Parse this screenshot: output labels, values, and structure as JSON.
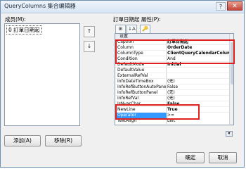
{
  "window": {
    "title": "QueryColumns 集合编辑器",
    "help_glyph": "?",
    "close_glyph": "✕"
  },
  "members": {
    "label": "成员(M):",
    "items": [
      "0 訂單日期起"
    ],
    "up_glyph": "↑",
    "down_glyph": "↓",
    "add_label": "添加(A)",
    "remove_label": "移除(R)"
  },
  "properties": {
    "label": "訂單日期起 屬性(P):",
    "toolbar": {
      "categorized_glyph": "⊞",
      "alphabetical_glyph": "↓A",
      "pages_glyph": "🔑"
    },
    "category": "设置",
    "rows": [
      {
        "name": "Caption",
        "value": "訂單日期起",
        "bold": true
      },
      {
        "name": "Column",
        "value": "OrderDate",
        "bold": true
      },
      {
        "name": "ColumnType",
        "value": "ClientQueryCalendarColumn",
        "bold": true
      },
      {
        "name": "Condition",
        "value": "And",
        "bold": false
      },
      {
        "name": "DefaultMode",
        "value": "Initial",
        "bold": true
      },
      {
        "name": "DefaultValue",
        "value": "",
        "bold": false
      },
      {
        "name": "ExternalRefVal",
        "value": "",
        "bold": false
      },
      {
        "name": "InfoDateTimeBox",
        "value": "(无)",
        "bold": false
      },
      {
        "name": "InfoRefButtonAutoPane",
        "value": "False",
        "bold": false
      },
      {
        "name": "InfoRefButtonPanel",
        "value": "(无)",
        "bold": false
      },
      {
        "name": "InfoRefVal",
        "value": "(无)",
        "bold": false
      },
      {
        "name": "IsNvarChar",
        "value": "False",
        "bold": true
      },
      {
        "name": "NewLine",
        "value": "True",
        "bold": true
      },
      {
        "name": "Operator",
        "value": ">=",
        "bold": false,
        "selected": true
      },
      {
        "name": "TextAlign",
        "value": "Left",
        "bold": false
      }
    ],
    "dropdown_glyph": "▾"
  },
  "footer": {
    "ok_label": "确定",
    "cancel_label": "取消"
  }
}
